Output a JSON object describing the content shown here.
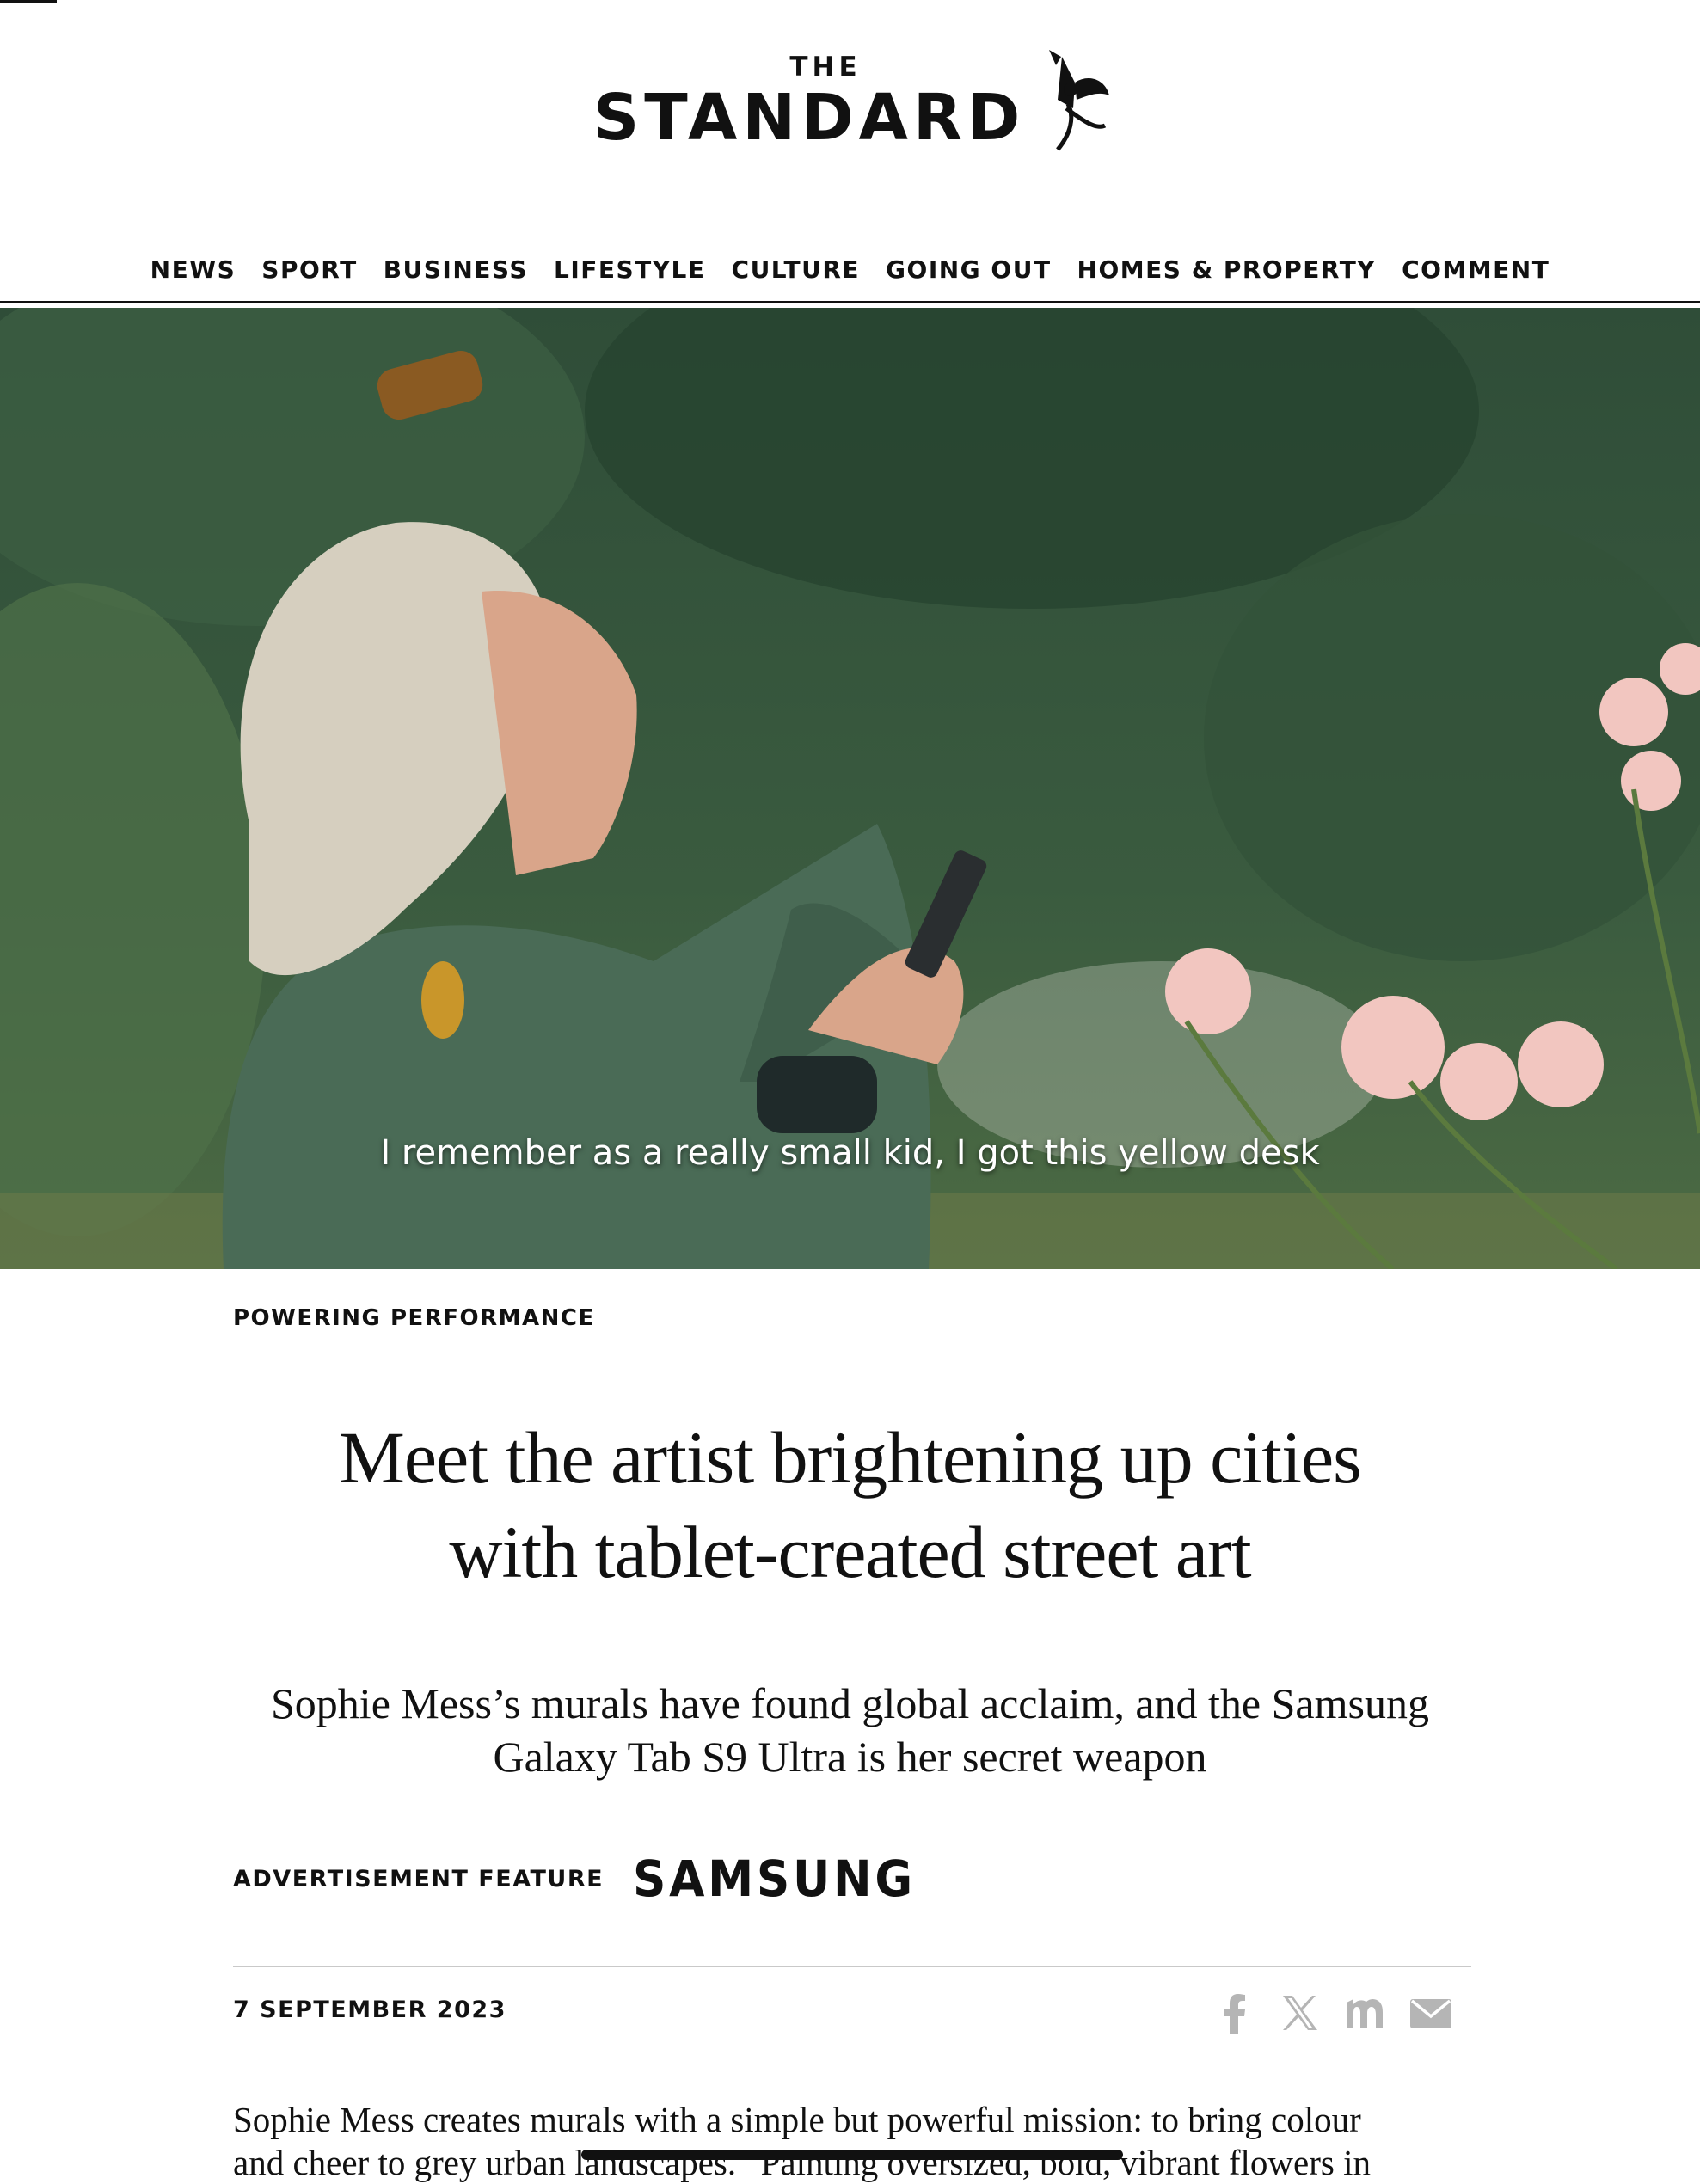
{
  "masthead": {
    "logo_top": "THE",
    "logo_main": "STANDARD",
    "logo_mark_icon": "winged-figure-icon"
  },
  "nav": {
    "items": [
      "NEWS",
      "SPORT",
      "BUSINESS",
      "LIFESTYLE",
      "CULTURE",
      "GOING OUT",
      "HOMES & PROPERTY",
      "COMMENT"
    ]
  },
  "hero": {
    "subtitle": "I remember as a really small kid, I got this yellow desk"
  },
  "article": {
    "kicker": "POWERING PERFORMANCE",
    "headline_line1": "Meet the artist brightening up cities",
    "headline_line2": "with tablet-created street art",
    "standfirst_line1": "Sophie Mess’s murals have found global acclaim, and the Samsung",
    "standfirst_line2": "Galaxy Tab S9 Ultra is her secret weapon",
    "ad_label": "ADVERTISEMENT FEATURE",
    "sponsor": "SAMSUNG",
    "date": "7 SEPTEMBER 2023",
    "share_icons": [
      "facebook-icon",
      "x-icon",
      "threads-icon",
      "email-icon"
    ],
    "body_line1": "Sophie Mess creates murals with a simple but powerful mission: to bring colour",
    "body_line2": "and cheer to grey urban landscapes. “Painting oversized, bold, vibrant flowers in"
  },
  "colors": {
    "text": "#111111",
    "rule": "#c9c9c9",
    "share_icon": "#b5b5b5",
    "hero_foliage": "#2d4a35",
    "jacket": "#4a6b56",
    "rose": "#f2c6c0"
  }
}
